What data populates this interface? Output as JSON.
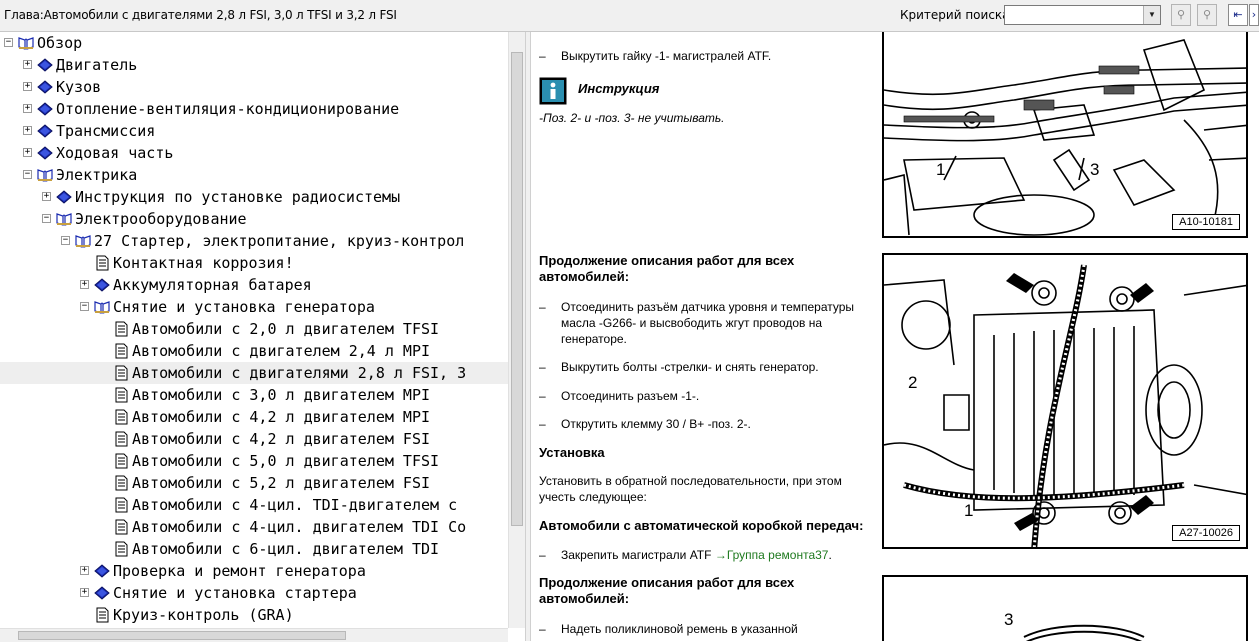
{
  "header": {
    "chapter_title": "Глава:Автомобили с двигателями 2,8 л FSI, 3,0 л TFSI и 3,2 л FSI",
    "criteria_label": "Критерий  поиска:",
    "criteria_value": ""
  },
  "tree": {
    "items": [
      {
        "label": "Обзор"
      },
      {
        "label": "Двигатель"
      },
      {
        "label": "Кузов"
      },
      {
        "label": "Отопление-вентиляция-кондиционирование"
      },
      {
        "label": "Трансмиссия"
      },
      {
        "label": "Ходовая часть"
      },
      {
        "label": "Электрика"
      },
      {
        "label": "Инструкция по установке радиосистемы"
      },
      {
        "label": "Электрооборудование"
      },
      {
        "label": "27 Стартер, электропитание, круиз-контрол"
      },
      {
        "label": "Контактная коррозия!"
      },
      {
        "label": "Аккумуляторная батарея"
      },
      {
        "label": "Снятие и установка генератора"
      },
      {
        "label": "Автомобили с 2,0 л двигателем TFSI"
      },
      {
        "label": "Автомобили с двигателем 2,4 л MPI"
      },
      {
        "label": "Автомобили с двигателями 2,8 л FSI, 3"
      },
      {
        "label": "Автомобили с 3,0 л двигателем MPI"
      },
      {
        "label": "Автомобили с 4,2 л двигателем MPI"
      },
      {
        "label": "Автомобили с 4,2 л двигателем FSI"
      },
      {
        "label": "Автомобили с 5,0 л двигателем TFSI"
      },
      {
        "label": "Автомобили с 5,2 л двигателем FSI"
      },
      {
        "label": "Автомобили с 4-цил. TDI-двигателем с"
      },
      {
        "label": "Автомобили с 4-цил. двигателем TDI Co"
      },
      {
        "label": "Автомобили с 6-цил. двигателем TDI"
      },
      {
        "label": "Проверка и ремонт генератора"
      },
      {
        "label": "Снятие и установка стартера"
      },
      {
        "label": "Круиз-контроль (GRA)"
      }
    ]
  },
  "content": {
    "step_unscrew_nut": "Выкрутить гайку -1- магистралей ATF.",
    "instruction_title": "Инструкция",
    "instruction_text": "-Поз. 2- и -поз. 3- не учитывать.",
    "continue_heading_1": "Продолжение описания работ для всех автомобилей:",
    "step_disconnect_sensor": "Отсоединить разъём датчика уровня и температуры масла -G266- и высвободить жгут проводов на генераторе.",
    "step_unscrew_bolts": "Выкрутить болты -стрелки- и снять генератор.",
    "step_disconnect_connector": "Отсоединить разъем -1-.",
    "step_unscrew_terminal": "Открутить клемму 30 / B+ -поз. 2-.",
    "install_heading": "Установка",
    "install_text": "Установить в обратной последовательности, при этом учесть следующее:",
    "auto_gearbox_heading": "Автомобили с автоматической коробкой передач:",
    "step_fasten_lines": "Закрепить магистрали ATF",
    "link_repair_group": "→Группа ремонта37",
    "link_suffix": ".",
    "continue_heading_2": "Продолжение описания работ для всех автомобилей:",
    "step_belt": "Надеть поликлиновой ремень в указанной",
    "dash": "–",
    "fig1": {
      "id": "A10-10181",
      "callout_1": "1",
      "callout_3": "3"
    },
    "fig2": {
      "id": "A27-10026",
      "callout_1": "1",
      "callout_2": "2"
    },
    "fig3": {
      "callout_3": "3"
    }
  }
}
